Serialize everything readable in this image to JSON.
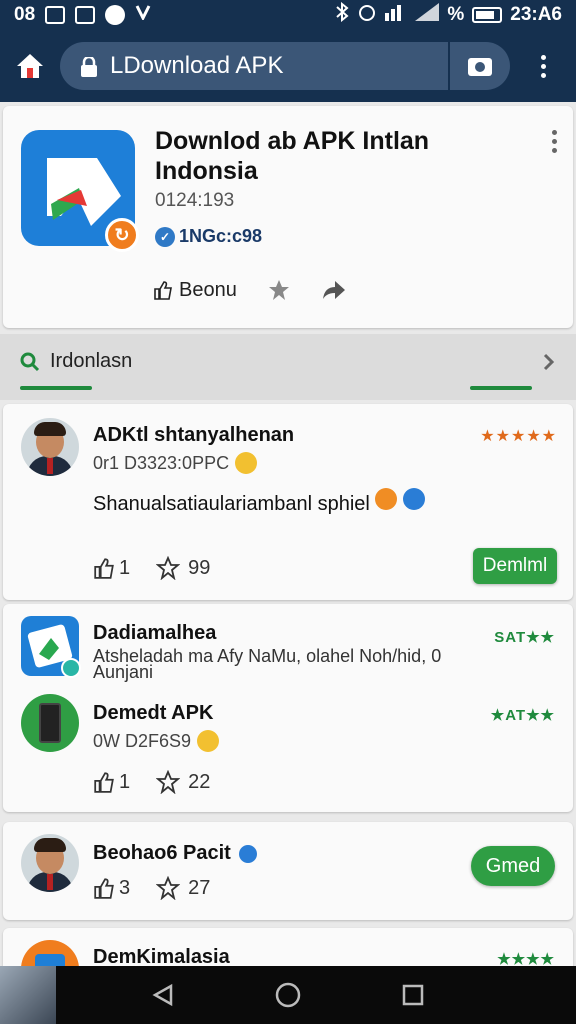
{
  "status_bar": {
    "left_text": "08",
    "time": "23:A6",
    "percent": "%"
  },
  "toolbar": {
    "url_text": "LDownload APK"
  },
  "app": {
    "title": "Downlod ab APK Intlan Indonsia",
    "version": "0124:193",
    "developer": "1NGc:c98",
    "action_label": "Beonu"
  },
  "search": {
    "label": "Irdonlasn"
  },
  "review": {
    "name": "ADKtl shtanyalhenan",
    "date": "0r1 D3323:0PPC",
    "text": "Shanualsatiaulariambanl sphiel",
    "stars": "★★★★★",
    "likes": "1",
    "rating_count": "99",
    "button": "Demlml"
  },
  "apps": {
    "item1": {
      "title": "Dadiamalhea",
      "desc": "Atsheladah ma Afy NaMu, olahel Noh/hid, 0 Aunjani",
      "rating": "SAT★★"
    },
    "item2": {
      "title": "Demedt APK",
      "date": "0W D2F6S9",
      "rating": "★AT★★",
      "likes": "1",
      "count": "22"
    }
  },
  "user": {
    "name": "Beohao6 Pacit",
    "likes": "3",
    "count": "27",
    "button": "Gmed"
  },
  "partial": {
    "title": "DemKimalasia",
    "rating": "★★★★"
  },
  "colors": {
    "toolbar": "#15304f",
    "accent_green": "#2f9e44",
    "star_orange": "#e06a1b"
  }
}
